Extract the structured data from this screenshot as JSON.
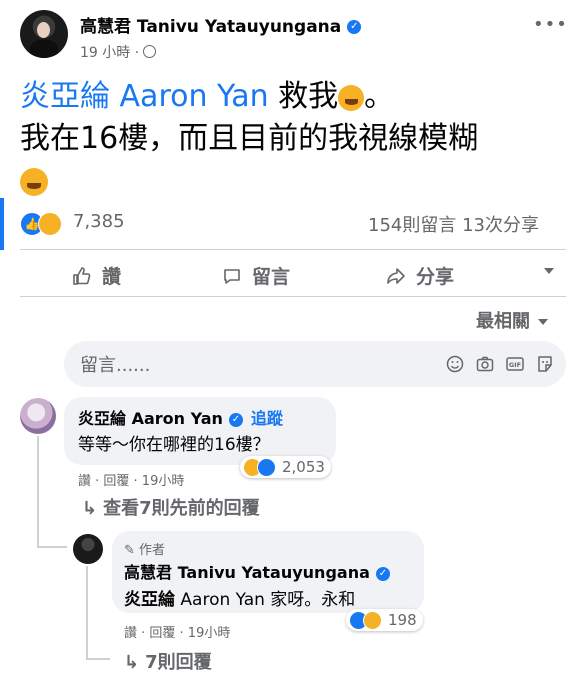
{
  "post": {
    "author_name": "高慧君 Tanivu Yatauyungana",
    "time": "19 小時 ·",
    "mention": "炎亞綸 Aaron Yan",
    "text_after_mention": " 救我",
    "text_period": "。",
    "line2": "我在16樓，而且目前的我視線模糊",
    "reaction_count": "7,385",
    "comments_shares": "154則留言 13次分享"
  },
  "actions": {
    "like": "讚",
    "comment": "留言",
    "share": "分享"
  },
  "sort_label": "最相關",
  "comment_input": {
    "placeholder": "留言......"
  },
  "comments": [
    {
      "name": "炎亞綸 Aaron Yan",
      "follow": "追蹤",
      "text": "等等～你在哪裡的16樓？",
      "reactions": "2,053",
      "meta": "讚 · 回覆 · 19小時",
      "view_previous": "查看7則先前的回覆"
    },
    {
      "author_tag": "作者",
      "name": "高慧君 Tanivu Yatauyungana",
      "text_bold": "炎亞綸",
      "text_rest": " Aaron Yan 家呀。永和",
      "reactions": "198",
      "meta": "讚 · 回覆 · 19小時",
      "more_replies": "7則回覆"
    }
  ],
  "colors": {
    "accent": "#1877f2",
    "muted": "#65676b",
    "bubble": "#f0f2f5",
    "haha": "#f7b125"
  }
}
